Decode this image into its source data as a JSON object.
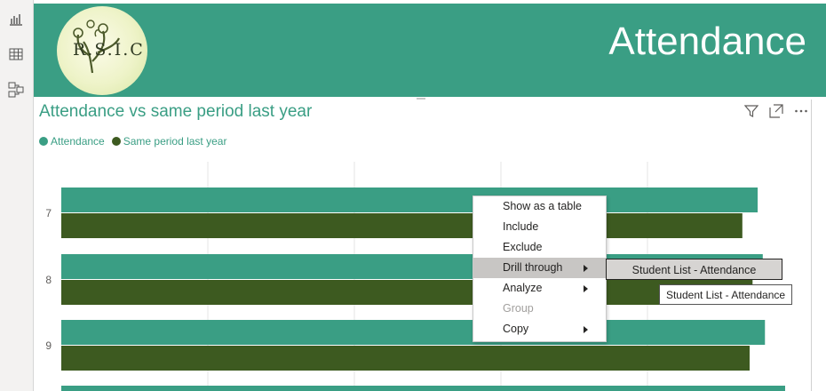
{
  "sidebar": {
    "items": [
      {
        "name": "report-view",
        "icon": "bar-chart-icon"
      },
      {
        "name": "data-view",
        "icon": "table-icon"
      },
      {
        "name": "model-view",
        "icon": "model-icon"
      }
    ]
  },
  "header": {
    "logo_text": "R.S.I.C",
    "title": "Attendance",
    "bg_color": "#3a9e84"
  },
  "visual": {
    "title": "Attendance vs same period last year",
    "tools": [
      "filter-icon",
      "focus-mode-icon",
      "more-options-icon"
    ]
  },
  "chart_data": {
    "type": "bar",
    "orientation": "horizontal",
    "categories": [
      "7",
      "8",
      "9"
    ],
    "series": [
      {
        "name": "Attendance",
        "color": "#3a9e84",
        "values": [
          95.5,
          96.2,
          96.5
        ]
      },
      {
        "name": "Same period last year",
        "color": "#3d5a20",
        "values": [
          93.4,
          94.8,
          94.4
        ]
      }
    ],
    "xlim": [
      0,
      100
    ],
    "grid": true,
    "legend": "top-left"
  },
  "context_menu": {
    "items": [
      {
        "label": "Show as a table",
        "highlighted": false,
        "disabled": false,
        "submenu": false
      },
      {
        "label": "Include",
        "highlighted": false,
        "disabled": false,
        "submenu": false
      },
      {
        "label": "Exclude",
        "highlighted": false,
        "disabled": false,
        "submenu": false
      },
      {
        "label": "Drill through",
        "highlighted": true,
        "disabled": false,
        "submenu": true
      },
      {
        "label": "Analyze",
        "highlighted": false,
        "disabled": false,
        "submenu": true
      },
      {
        "label": "Group",
        "highlighted": false,
        "disabled": true,
        "submenu": false
      },
      {
        "label": "Copy",
        "highlighted": false,
        "disabled": false,
        "submenu": true
      }
    ]
  },
  "submenu": {
    "label": "Student List - Attendance"
  },
  "tooltip": {
    "label": "Student List - Attendance"
  }
}
